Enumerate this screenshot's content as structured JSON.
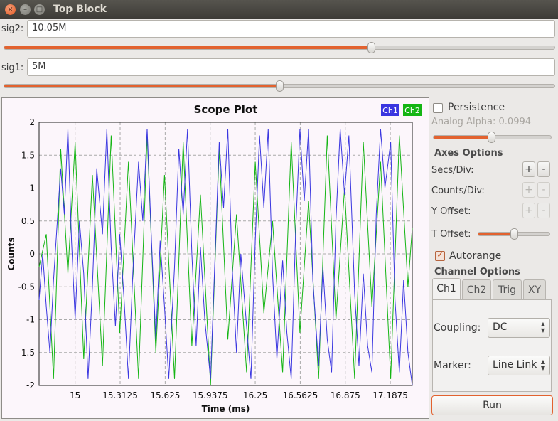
{
  "window": {
    "title": "Top Block"
  },
  "sig2": {
    "label": "sig2:",
    "value": "10.05M",
    "slider_fraction": 0.667
  },
  "sig1": {
    "label": "sig1:",
    "value": "5M",
    "slider_fraction": 0.5
  },
  "side": {
    "persistence_label": "Persistence",
    "persistence_checked": false,
    "analog_alpha_label": "Analog Alpha: 0.0994",
    "analog_alpha_fraction": 0.49,
    "axes_options_title": "Axes Options",
    "secs_div_label": "Secs/Div:",
    "counts_div_label": "Counts/Div:",
    "y_offset_label": "Y Offset:",
    "t_offset_label": "T Offset:",
    "t_offset_fraction": 0.5,
    "plus": "+",
    "minus": "-",
    "autorange_label": "Autorange",
    "autorange_checked": true,
    "channel_options_title": "Channel Options",
    "tabs": [
      "Ch1",
      "Ch2",
      "Trig",
      "XY"
    ],
    "active_tab": "Ch1",
    "coupling_label": "Coupling:",
    "coupling_value": "DC",
    "marker_label": "Marker:",
    "marker_value": "Line Link",
    "run_label": "Run"
  },
  "colors": {
    "ch1": "#3a36e0",
    "ch2": "#14b514",
    "accent": "#e2622f"
  },
  "chart_data": {
    "type": "line",
    "title": "Scope Plot",
    "xlabel": "Time (ms)",
    "ylabel": "Counts",
    "xlim": [
      14.75,
      17.34
    ],
    "ylim": [
      -2,
      2
    ],
    "x_ticks": [
      "15",
      "15.3125",
      "15.625",
      "15.9375",
      "16.25",
      "16.5625",
      "16.875",
      "17.1875"
    ],
    "y_ticks": [
      "2",
      "1.5",
      "1",
      "0.5",
      "0",
      "-0.5",
      "-1",
      "-1.5",
      "-2"
    ],
    "grid": true,
    "legend": [
      "Ch1",
      "Ch2"
    ],
    "legend_position": "top-right",
    "series": [
      {
        "name": "Ch1",
        "color": "#3a36e0",
        "x": [
          14.75,
          14.775,
          14.8,
          14.825,
          14.85,
          14.9,
          14.925,
          14.95,
          14.975,
          15.0,
          15.03,
          15.06,
          15.09,
          15.12,
          15.15,
          15.19,
          15.22,
          15.25,
          15.28,
          15.31,
          15.34,
          15.37,
          15.4,
          15.44,
          15.47,
          15.5,
          15.53,
          15.56,
          15.59,
          15.62,
          15.65,
          15.69,
          15.72,
          15.75,
          15.78,
          15.81,
          15.84,
          15.87,
          15.9,
          15.94,
          15.97,
          16.0,
          16.03,
          16.06,
          16.09,
          16.12,
          16.15,
          16.19,
          16.22,
          16.25,
          16.28,
          16.31,
          16.34,
          16.37,
          16.4,
          16.44,
          16.47,
          16.5,
          16.53,
          16.56,
          16.59,
          16.62,
          16.65,
          16.69,
          16.72,
          16.75,
          16.78,
          16.81,
          16.84,
          16.87,
          16.9,
          16.94,
          16.97,
          17.0,
          17.03,
          17.06,
          17.09,
          17.12,
          17.15,
          17.19,
          17.22,
          17.25,
          17.28,
          17.31,
          17.34
        ],
        "y": [
          -0.7,
          0.0,
          -0.8,
          -1.5,
          -0.4,
          1.3,
          0.6,
          1.9,
          0.2,
          -1.0,
          0.5,
          -0.3,
          -1.9,
          -0.5,
          1.3,
          0.3,
          1.9,
          0.1,
          -1.1,
          0.3,
          -0.7,
          -1.9,
          -0.3,
          1.4,
          0.5,
          1.9,
          0.2,
          -1.3,
          0.2,
          -0.8,
          -1.9,
          -0.2,
          1.6,
          0.6,
          1.9,
          0.0,
          -1.4,
          0.1,
          -1.0,
          -1.9,
          -0.1,
          1.7,
          0.7,
          1.9,
          -0.2,
          -1.5,
          0.0,
          -1.1,
          -1.9,
          0.2,
          1.8,
          0.7,
          1.9,
          -0.3,
          -1.6,
          -0.1,
          -1.2,
          -1.9,
          0.3,
          1.9,
          0.8,
          1.9,
          -0.4,
          -1.7,
          -0.2,
          -1.3,
          -1.8,
          0.5,
          1.9,
          0.9,
          1.8,
          -0.6,
          -1.7,
          -0.3,
          -1.4,
          -1.8,
          0.6,
          1.9,
          1.0,
          1.7,
          -0.7,
          -1.8,
          -0.4,
          -1.5,
          -2.0
        ]
      },
      {
        "name": "Ch2",
        "color": "#14b514",
        "x": [
          14.75,
          14.8,
          14.85,
          14.9,
          14.95,
          15.0,
          15.06,
          15.12,
          15.19,
          15.25,
          15.31,
          15.37,
          15.44,
          15.5,
          15.56,
          15.62,
          15.69,
          15.75,
          15.81,
          15.87,
          15.94,
          16.0,
          16.06,
          16.12,
          16.19,
          16.25,
          16.31,
          16.37,
          16.44,
          16.5,
          16.56,
          16.62,
          16.69,
          16.75,
          16.81,
          16.87,
          16.94,
          17.0,
          17.06,
          17.12,
          17.19,
          17.25,
          17.31,
          17.34
        ],
        "y": [
          -0.2,
          0.3,
          -1.9,
          1.6,
          -0.3,
          1.7,
          -1.6,
          1.2,
          -1.7,
          1.8,
          -1.2,
          1.4,
          -1.9,
          1.8,
          -1.5,
          1.2,
          -1.9,
          1.7,
          -1.4,
          0.9,
          -2.0,
          1.6,
          -1.3,
          0.6,
          -1.8,
          1.4,
          -0.9,
          0.5,
          -1.8,
          1.7,
          -1.2,
          0.8,
          -1.9,
          1.8,
          -1.0,
          1.0,
          -1.9,
          1.7,
          -0.8,
          1.4,
          -1.9,
          1.8,
          -0.5,
          0.4
        ]
      }
    ]
  }
}
